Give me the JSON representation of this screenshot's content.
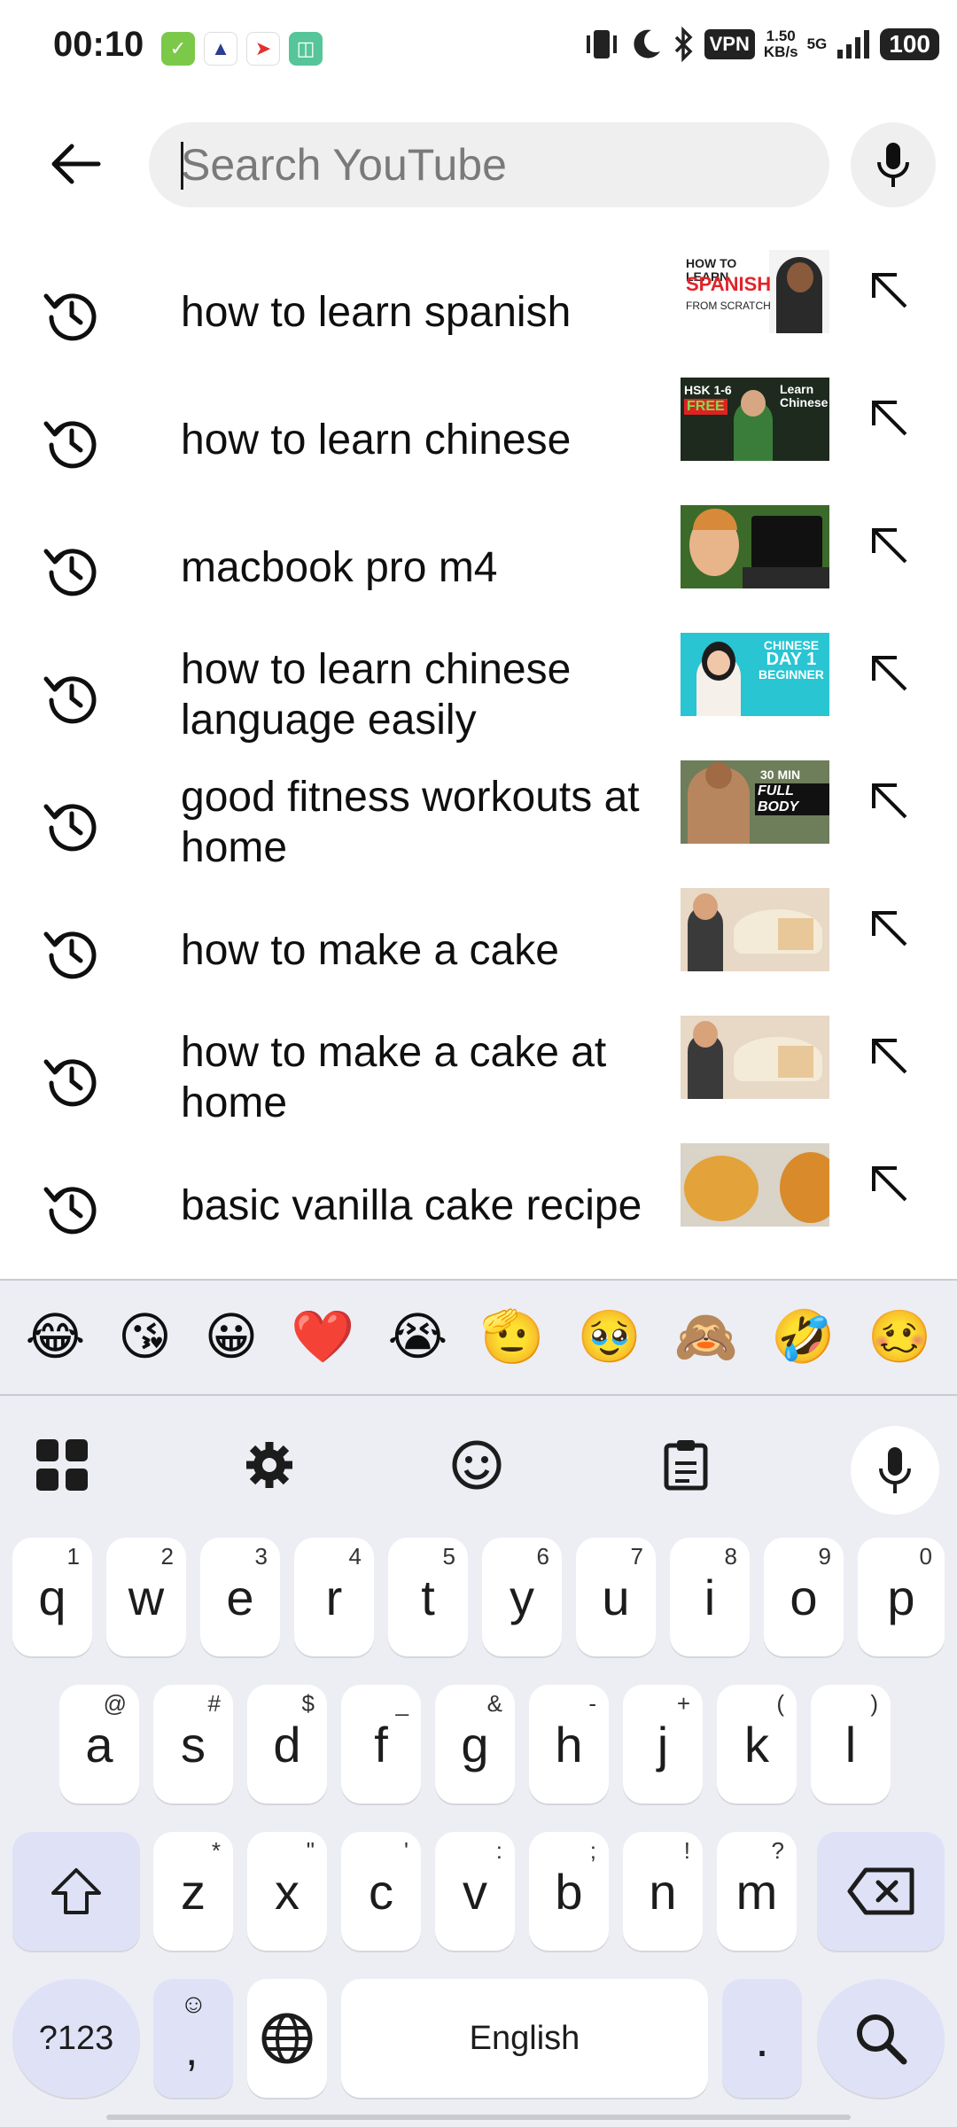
{
  "status_bar": {
    "time": "00:10",
    "vpn": "VPN",
    "speed_value": "1.50",
    "speed_unit": "KB/s",
    "network": "5G",
    "battery": "100"
  },
  "search": {
    "placeholder": "Search YouTube",
    "value": ""
  },
  "suggestions": [
    {
      "text": "how to learn spanish",
      "thumb_label": "HOW TO LEARN SPANISH FROM SCRATCH",
      "thumb_color": "#f3f3f3"
    },
    {
      "text": "how to learn chinese",
      "thumb_label": "HSK 1-6 FREE Learn Chinese",
      "thumb_color": "#1d2a1d"
    },
    {
      "text": "macbook pro m4",
      "thumb_label": "",
      "thumb_color": "#3b6a2a"
    },
    {
      "text": "how to learn chinese language easily",
      "thumb_label": "CHINESE DAY 1 BEGINNER 1.1",
      "thumb_color": "#29c5d3"
    },
    {
      "text": "good fitness workouts at home",
      "thumb_label": "30 MIN FULL BODY",
      "thumb_color": "#6e7d5a"
    },
    {
      "text": "how to make a cake",
      "thumb_label": "",
      "thumb_color": "#e8d8c6"
    },
    {
      "text": "how to make a cake at home",
      "thumb_label": "",
      "thumb_color": "#e8d8c6"
    },
    {
      "text": "basic vanilla cake recipe",
      "thumb_label": "",
      "thumb_color": "#e3a23a"
    }
  ],
  "keyboard": {
    "emojis": [
      "😂",
      "😘",
      "😀",
      "❤️",
      "😭",
      "🫡",
      "🥹",
      "🙈",
      "🤣",
      "🥴"
    ],
    "row1": [
      {
        "key": "q",
        "hint": "1"
      },
      {
        "key": "w",
        "hint": "2"
      },
      {
        "key": "e",
        "hint": "3"
      },
      {
        "key": "r",
        "hint": "4"
      },
      {
        "key": "t",
        "hint": "5"
      },
      {
        "key": "y",
        "hint": "6"
      },
      {
        "key": "u",
        "hint": "7"
      },
      {
        "key": "i",
        "hint": "8"
      },
      {
        "key": "o",
        "hint": "9"
      },
      {
        "key": "p",
        "hint": "0"
      }
    ],
    "row2": [
      {
        "key": "a",
        "hint": "@"
      },
      {
        "key": "s",
        "hint": "#"
      },
      {
        "key": "d",
        "hint": "$"
      },
      {
        "key": "f",
        "hint": "_"
      },
      {
        "key": "g",
        "hint": "&"
      },
      {
        "key": "h",
        "hint": "-"
      },
      {
        "key": "j",
        "hint": "+"
      },
      {
        "key": "k",
        "hint": "("
      },
      {
        "key": "l",
        "hint": ")"
      }
    ],
    "row3": [
      {
        "key": "z",
        "hint": "*"
      },
      {
        "key": "x",
        "hint": "\""
      },
      {
        "key": "c",
        "hint": "'"
      },
      {
        "key": "v",
        "hint": ":"
      },
      {
        "key": "b",
        "hint": ";"
      },
      {
        "key": "n",
        "hint": "!"
      },
      {
        "key": "m",
        "hint": "?"
      }
    ],
    "symbols_key": "?123",
    "comma_key": ",",
    "space_label": "English",
    "period_key": "."
  }
}
